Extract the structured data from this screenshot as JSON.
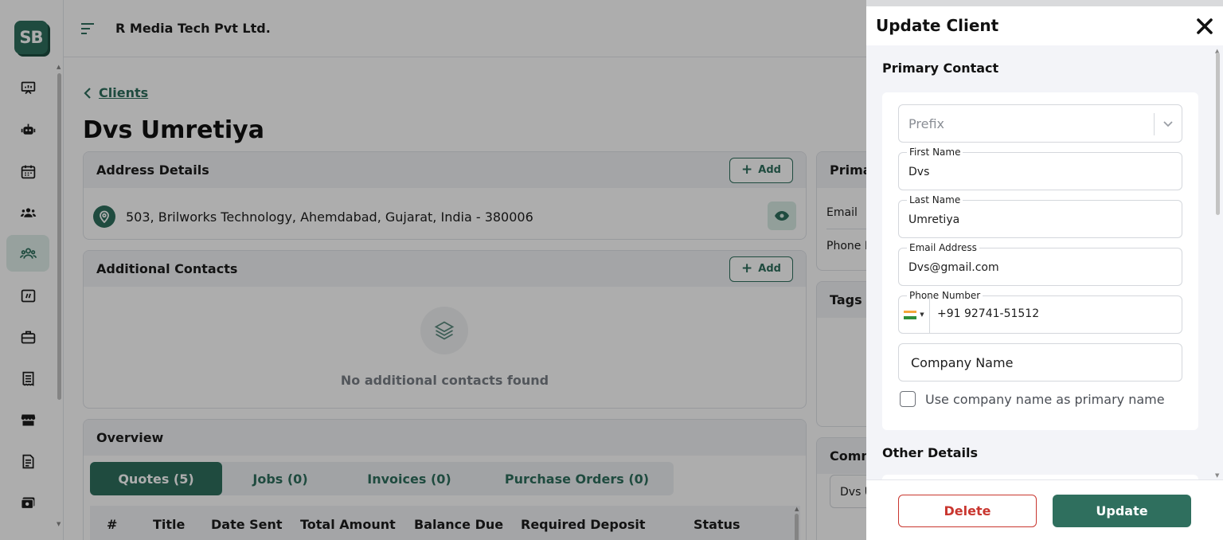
{
  "sidebar": {
    "logo_text": "SB",
    "items": [
      {
        "icon": "presentation-icon"
      },
      {
        "icon": "robot-icon"
      },
      {
        "icon": "calendar-icon"
      },
      {
        "icon": "team-icon"
      },
      {
        "icon": "clients-icon",
        "active": true
      },
      {
        "icon": "activity-icon"
      },
      {
        "icon": "briefcase-icon"
      },
      {
        "icon": "receipt-icon"
      },
      {
        "icon": "store-icon"
      },
      {
        "icon": "report-icon"
      },
      {
        "icon": "payment-icon"
      }
    ]
  },
  "header": {
    "company": "R Media Tech Pvt Ltd."
  },
  "breadcrumb": {
    "label": "Clients"
  },
  "page": {
    "title": "Dvs Umretiya"
  },
  "address": {
    "title": "Address Details",
    "add_label": "Add",
    "line": "503, Brilworks Technology, Ahemdabad, Gujarat, India - 380006"
  },
  "contacts": {
    "title": "Additional Contacts",
    "add_label": "Add",
    "empty_text": "No additional contacts found"
  },
  "overview": {
    "title": "Overview",
    "tabs": [
      {
        "label": "Quotes (5)",
        "active": true
      },
      {
        "label": "Jobs (0)"
      },
      {
        "label": "Invoices (0)"
      },
      {
        "label": "Purchase Orders (0)"
      }
    ],
    "columns": [
      "#",
      "Title",
      "Date Sent",
      "Total Amount",
      "Balance Due",
      "Required Deposit",
      "Status"
    ]
  },
  "right_panel": {
    "primary_title": "Prima",
    "email_label": "Email",
    "phone_label": "Phone N",
    "tags_title": "Tags",
    "comm_title": "Comm",
    "comm_value": "Dvs U"
  },
  "drawer": {
    "title": "Update Client",
    "primary_section": "Primary Contact",
    "prefix_placeholder": "Prefix",
    "first_name_label": "First Name",
    "first_name": "Dvs",
    "last_name_label": "Last Name",
    "last_name": "Umretiya",
    "email_label": "Email Address",
    "email": "Dvs@gmail.com",
    "phone_label": "Phone Number",
    "phone": "+91 92741-51512",
    "company_placeholder": "Company Name",
    "use_company_label": "Use company name as primary name",
    "other_section": "Other Details",
    "delete_label": "Delete",
    "update_label": "Update"
  },
  "colors": {
    "brand": "#2f6f5e",
    "danger": "#c9362f",
    "overlay": "rgba(0,0,0,0.32)"
  }
}
